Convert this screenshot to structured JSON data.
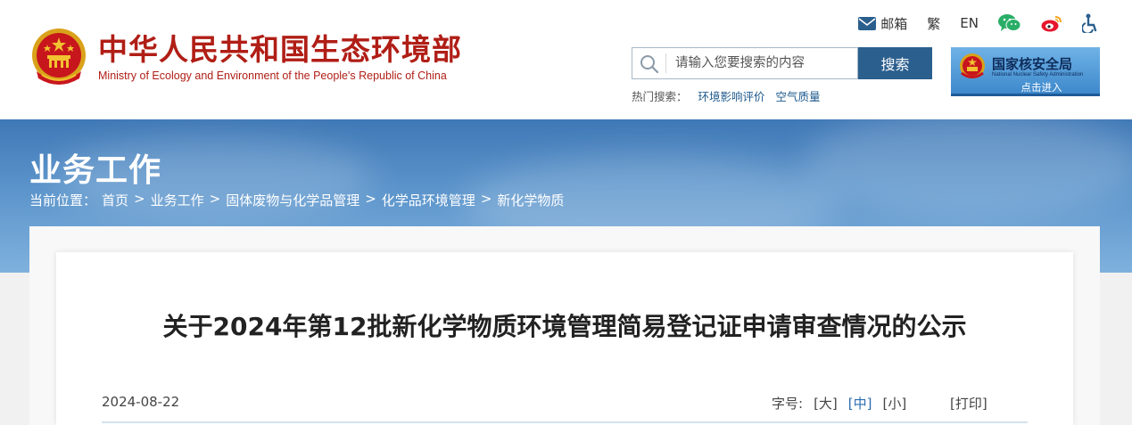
{
  "header": {
    "title_cn": "中华人民共和国生态环境部",
    "title_en": "Ministry of Ecology and Environment of the People's Republic of China",
    "top_links": {
      "mail": "邮箱",
      "traditional": "繁",
      "english": "EN"
    },
    "icons": [
      "national-emblem-icon",
      "mail-icon",
      "wechat-icon",
      "weibo-icon",
      "accessibility-icon",
      "search-icon"
    ],
    "colors": {
      "brand_red": "#b01e16",
      "primary_blue": "#2b5f8e",
      "wechat_green": "#2aae67",
      "weibo_red": "#e6162d",
      "accessibility_blue": "#2b5f8e"
    }
  },
  "search": {
    "placeholder": "请输入您要搜索的内容",
    "button_label": "搜索",
    "hot_label": "热门搜索：",
    "hot_items": [
      "环境影响评价",
      "空气质量"
    ]
  },
  "nnsa": {
    "title": "国家核安全局",
    "subtitle_en": "National Nuclear Safety Administration",
    "enter_label": "点击进入"
  },
  "banner": {
    "section_title": "业务工作",
    "breadcrumb": {
      "label": "当前位置：",
      "items": [
        "首页",
        "业务工作",
        "固体废物与化学品管理",
        "化学品环境管理",
        "新化学物质"
      ],
      "separator": ">"
    }
  },
  "article": {
    "title": "关于2024年第12批新化学物质环境管理简易登记证申请审查情况的公示",
    "date": "2024-08-22",
    "font_size_label": "字号:",
    "font_sizes": [
      "[大]",
      "[中]",
      "[小]"
    ],
    "active_font_size": "[中]",
    "print_label": "[打印]"
  }
}
